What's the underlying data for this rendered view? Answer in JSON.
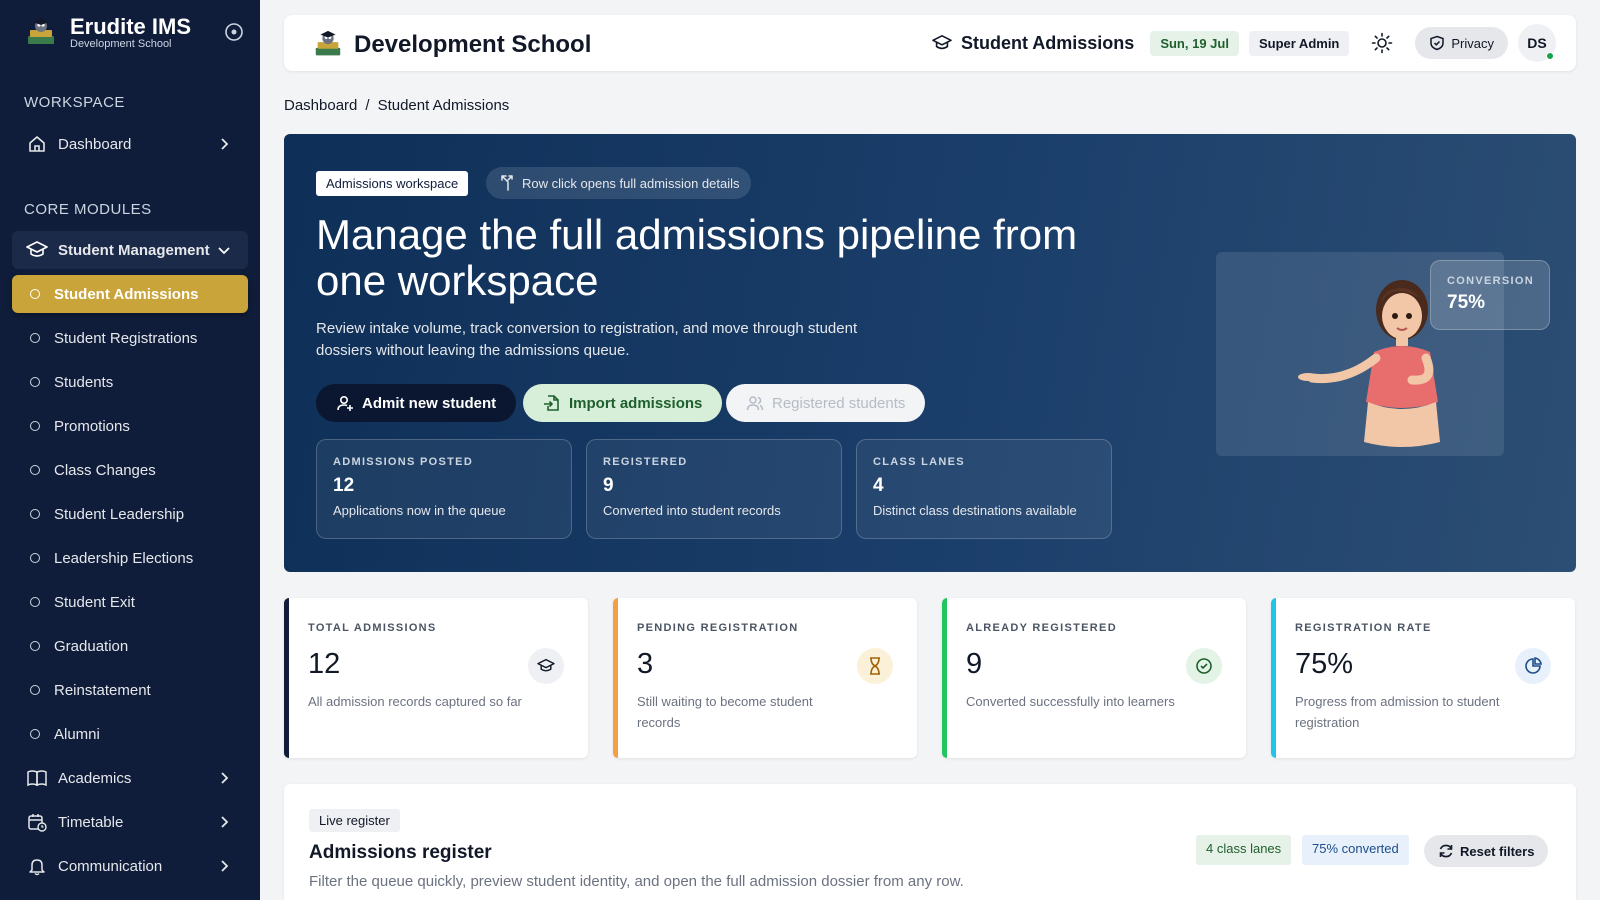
{
  "sidebar": {
    "brand_title": "Erudite IMS",
    "brand_subtitle": "Development School",
    "workspace_label": "WORKSPACE",
    "dashboard_label": "Dashboard",
    "core_label": "CORE MODULES",
    "group_label": "Student Management",
    "sub_items": [
      "Student Admissions",
      "Student Registrations",
      "Students",
      "Promotions",
      "Class Changes",
      "Student Leadership",
      "Leadership Elections",
      "Student Exit",
      "Graduation",
      "Reinstatement",
      "Alumni"
    ],
    "academics_label": "Academics",
    "timetable_label": "Timetable",
    "communication_label": "Communication"
  },
  "topbar": {
    "school_name": "Development School",
    "page_title": "Student Admissions",
    "date": "Sun, 19 Jul",
    "role": "Super Admin",
    "privacy_label": "Privacy",
    "avatar_initials": "DS"
  },
  "breadcrumb": {
    "home": "Dashboard",
    "separator": "/",
    "current": "Student Admissions"
  },
  "hero": {
    "tag": "Admissions workspace",
    "hint": "Row click opens full admission details",
    "title": "Manage the full admissions pipeline from one workspace",
    "description": "Review intake volume, track conversion to registration, and move through student dossiers without leaving the admissions queue.",
    "btn_admit": "Admit new student",
    "btn_import": "Import admissions",
    "btn_registered": "Registered students",
    "stats": [
      {
        "label": "ADMISSIONS POSTED",
        "value": "12",
        "desc": "Applications now in the queue"
      },
      {
        "label": "REGISTERED",
        "value": "9",
        "desc": "Converted into student records"
      },
      {
        "label": "CLASS LANES",
        "value": "4",
        "desc": "Distinct class destinations available"
      }
    ],
    "conversion_label": "CONVERSION",
    "conversion_value": "75%"
  },
  "kpis": [
    {
      "label": "TOTAL ADMISSIONS",
      "value": "12",
      "desc": "All admission records captured so far",
      "color": "#0f1d3a"
    },
    {
      "label": "PENDING REGISTRATION",
      "value": "3",
      "desc": "Still waiting to become student records",
      "color": "#f59e42"
    },
    {
      "label": "ALREADY REGISTERED",
      "value": "9",
      "desc": "Converted successfully into learners",
      "color": "#22c55e"
    },
    {
      "label": "REGISTRATION RATE",
      "value": "75%",
      "desc": "Progress from admission to student registration",
      "color": "#22c5e6"
    }
  ],
  "register": {
    "tag": "Live register",
    "title": "Admissions register",
    "description": "Filter the queue quickly, preview student identity, and open the full admission dossier from any row.",
    "pill_lanes": "4 class lanes",
    "pill_converted": "75% converted",
    "reset_label": "Reset filters"
  }
}
